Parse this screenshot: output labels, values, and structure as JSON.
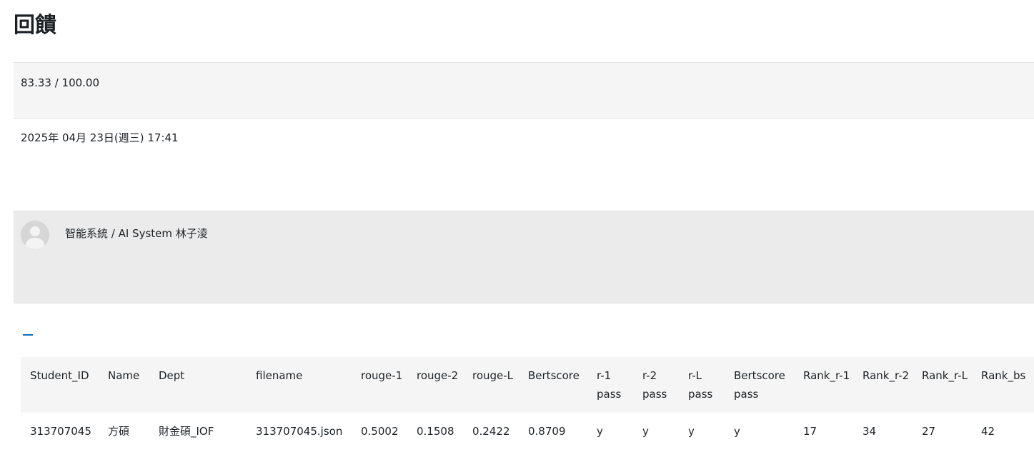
{
  "page": {
    "title": "回饋"
  },
  "grade": {
    "value": "83.33 / 100.00"
  },
  "submission": {
    "date": "2025年 04月 23日(週三) 17:41"
  },
  "grader": {
    "name": "智能系統 / AI System 林子淩",
    "avatar_icon": "user-avatar-icon"
  },
  "toggle": {
    "icon": "collapse-minus-icon",
    "color": "#0f6cbf"
  },
  "table": {
    "headers": [
      "Student_ID",
      "Name",
      "Dept",
      "filename",
      "rouge-1",
      "rouge-2",
      "rouge-L",
      "Bertscore",
      "r-1 pass",
      "r-2 pass",
      "r-L pass",
      "Bertscore pass",
      "Rank_r-1",
      "Rank_r-2",
      "Rank_r-L",
      "Rank_bs"
    ],
    "rows": [
      [
        "313707045",
        "方碩",
        "財金碩_IOF",
        "313707045.json",
        "0.5002",
        "0.1508",
        "0.2422",
        "0.8709",
        "y",
        "y",
        "y",
        "y",
        "17",
        "34",
        "27",
        "42"
      ]
    ]
  }
}
